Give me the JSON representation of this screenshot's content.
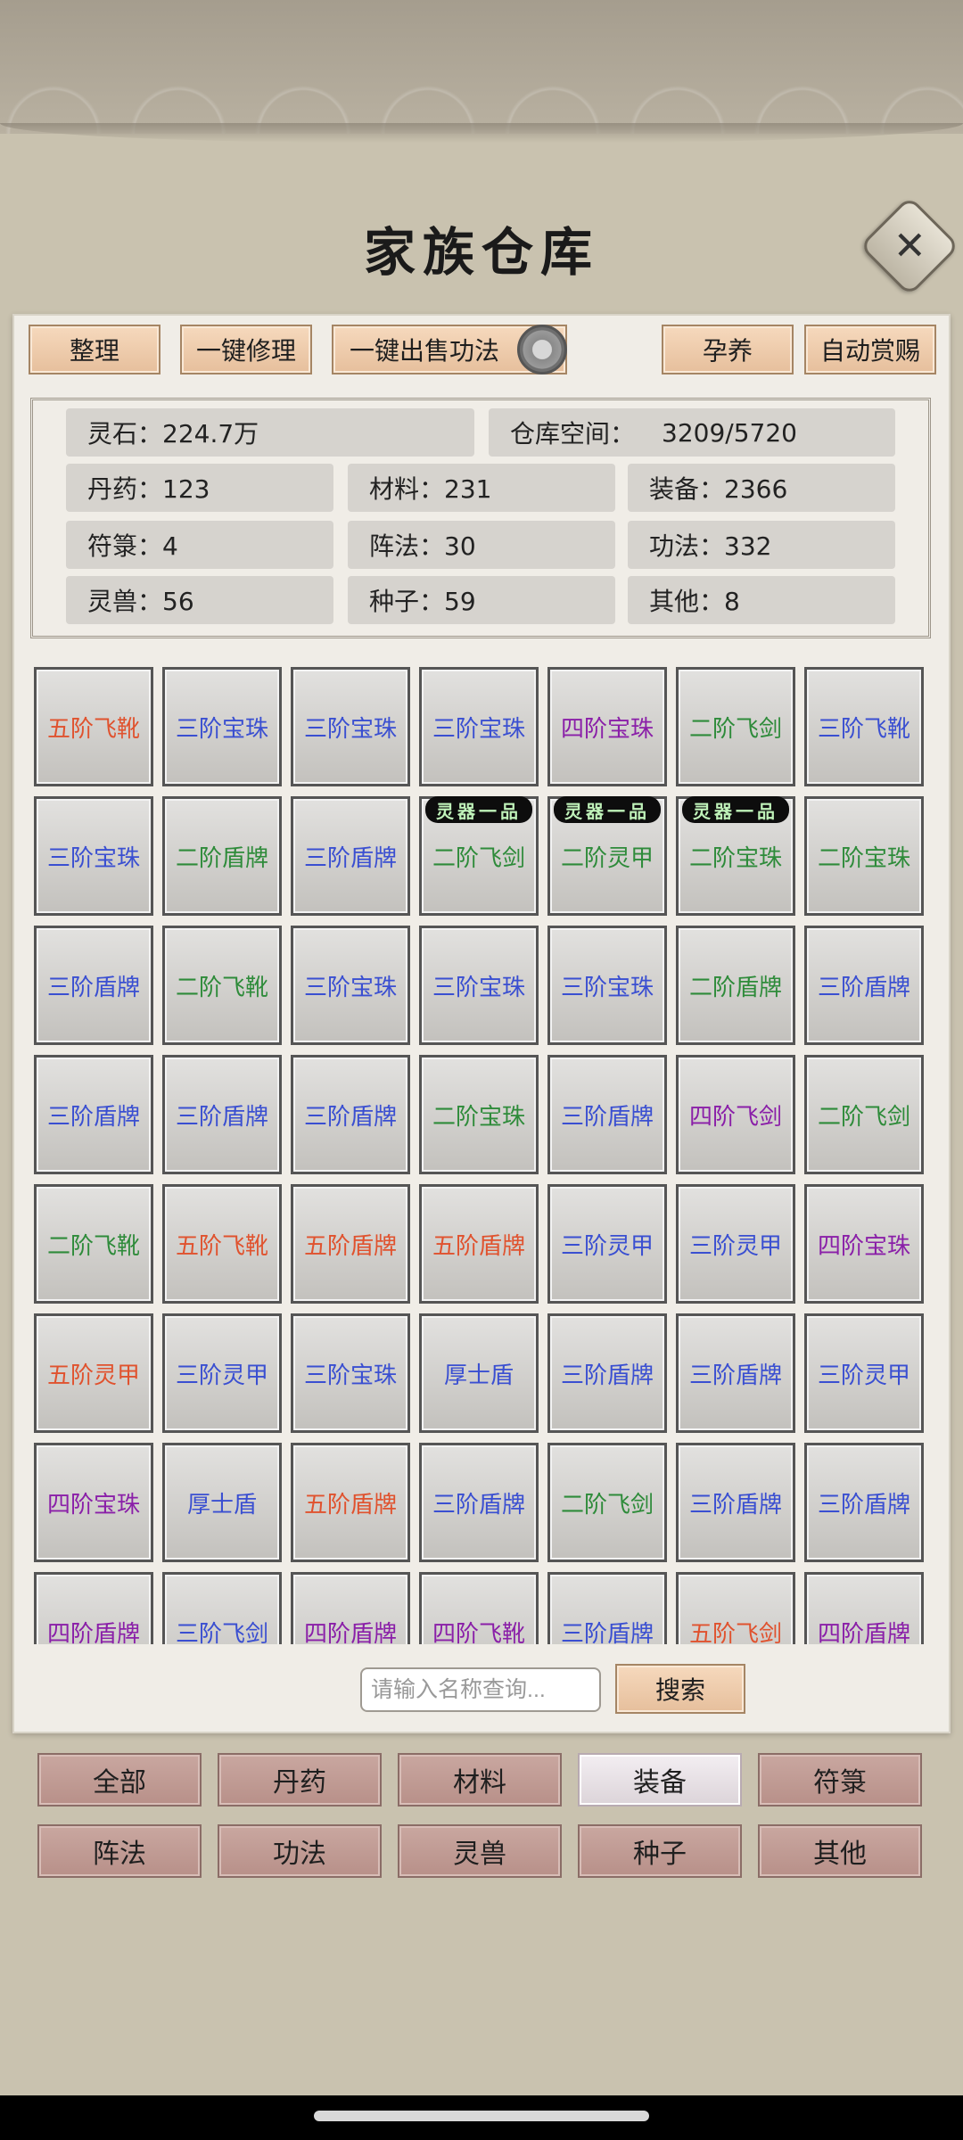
{
  "title": "家族仓库",
  "close_symbol": "✕",
  "toolbar": {
    "organize": "整理",
    "repair_all": "一键修理",
    "sell_skills": "一键出售功法",
    "breed": "孕养",
    "auto_reward": "自动赏赐"
  },
  "stats": {
    "spirit_stone": "灵石：224.7万",
    "capacity_label": "仓库空间：",
    "capacity_value": "3209/5720",
    "pills": "丹药：123",
    "materials": "材料：231",
    "equipment": "装备：2366",
    "talismans": "符箓：4",
    "formations": "阵法：30",
    "skills": "功法：332",
    "beasts": "灵兽：56",
    "seeds": "种子：59",
    "others": "其他：8"
  },
  "colors": {
    "tier2": "#2e8b3a",
    "tier3": "#3a4fd1",
    "tier4": "#8a1fa8",
    "tier5": "#e0522e"
  },
  "grid": [
    [
      {
        "t": "五阶飞靴",
        "c": "tier5"
      },
      {
        "t": "三阶宝珠",
        "c": "tier3"
      },
      {
        "t": "三阶宝珠",
        "c": "tier3"
      },
      {
        "t": "三阶宝珠",
        "c": "tier3"
      },
      {
        "t": "四阶宝珠",
        "c": "tier4"
      },
      {
        "t": "二阶飞剑",
        "c": "tier2"
      },
      {
        "t": "三阶飞靴",
        "c": "tier3"
      }
    ],
    [
      {
        "t": "三阶宝珠",
        "c": "tier3"
      },
      {
        "t": "二阶盾牌",
        "c": "tier2"
      },
      {
        "t": "三阶盾牌",
        "c": "tier3"
      },
      {
        "t": "二阶飞剑",
        "c": "tier2",
        "tag": "灵器一品"
      },
      {
        "t": "二阶灵甲",
        "c": "tier2",
        "tag": "灵器一品"
      },
      {
        "t": "二阶宝珠",
        "c": "tier2",
        "tag": "灵器一品"
      },
      {
        "t": "二阶宝珠",
        "c": "tier2"
      }
    ],
    [
      {
        "t": "三阶盾牌",
        "c": "tier3"
      },
      {
        "t": "二阶飞靴",
        "c": "tier2"
      },
      {
        "t": "三阶宝珠",
        "c": "tier3"
      },
      {
        "t": "三阶宝珠",
        "c": "tier3"
      },
      {
        "t": "三阶宝珠",
        "c": "tier3"
      },
      {
        "t": "二阶盾牌",
        "c": "tier2"
      },
      {
        "t": "三阶盾牌",
        "c": "tier3"
      }
    ],
    [
      {
        "t": "三阶盾牌",
        "c": "tier3"
      },
      {
        "t": "三阶盾牌",
        "c": "tier3"
      },
      {
        "t": "三阶盾牌",
        "c": "tier3"
      },
      {
        "t": "二阶宝珠",
        "c": "tier2"
      },
      {
        "t": "三阶盾牌",
        "c": "tier3"
      },
      {
        "t": "四阶飞剑",
        "c": "tier4"
      },
      {
        "t": "二阶飞剑",
        "c": "tier2"
      }
    ],
    [
      {
        "t": "二阶飞靴",
        "c": "tier2"
      },
      {
        "t": "五阶飞靴",
        "c": "tier5"
      },
      {
        "t": "五阶盾牌",
        "c": "tier5"
      },
      {
        "t": "五阶盾牌",
        "c": "tier5"
      },
      {
        "t": "三阶灵甲",
        "c": "tier3"
      },
      {
        "t": "三阶灵甲",
        "c": "tier3"
      },
      {
        "t": "四阶宝珠",
        "c": "tier4"
      }
    ],
    [
      {
        "t": "五阶灵甲",
        "c": "tier5"
      },
      {
        "t": "三阶灵甲",
        "c": "tier3"
      },
      {
        "t": "三阶宝珠",
        "c": "tier3"
      },
      {
        "t": "厚士盾",
        "c": "tier3"
      },
      {
        "t": "三阶盾牌",
        "c": "tier3"
      },
      {
        "t": "三阶盾牌",
        "c": "tier3"
      },
      {
        "t": "三阶灵甲",
        "c": "tier3"
      }
    ],
    [
      {
        "t": "四阶宝珠",
        "c": "tier4"
      },
      {
        "t": "厚士盾",
        "c": "tier3"
      },
      {
        "t": "五阶盾牌",
        "c": "tier5"
      },
      {
        "t": "三阶盾牌",
        "c": "tier3"
      },
      {
        "t": "二阶飞剑",
        "c": "tier2"
      },
      {
        "t": "三阶盾牌",
        "c": "tier3"
      },
      {
        "t": "三阶盾牌",
        "c": "tier3"
      }
    ],
    [
      {
        "t": "四阶盾牌",
        "c": "tier4"
      },
      {
        "t": "三阶飞剑",
        "c": "tier3"
      },
      {
        "t": "四阶盾牌",
        "c": "tier4"
      },
      {
        "t": "四阶飞靴",
        "c": "tier4"
      },
      {
        "t": "三阶盾牌",
        "c": "tier3"
      },
      {
        "t": "五阶飞剑",
        "c": "tier5"
      },
      {
        "t": "四阶盾牌",
        "c": "tier4"
      }
    ]
  ],
  "search": {
    "placeholder": "请输入名称查询...",
    "button": "搜索"
  },
  "categories": [
    "全部",
    "丹药",
    "材料",
    "装备",
    "符箓",
    "阵法",
    "功法",
    "灵兽",
    "种子",
    "其他"
  ],
  "active_category": "装备"
}
